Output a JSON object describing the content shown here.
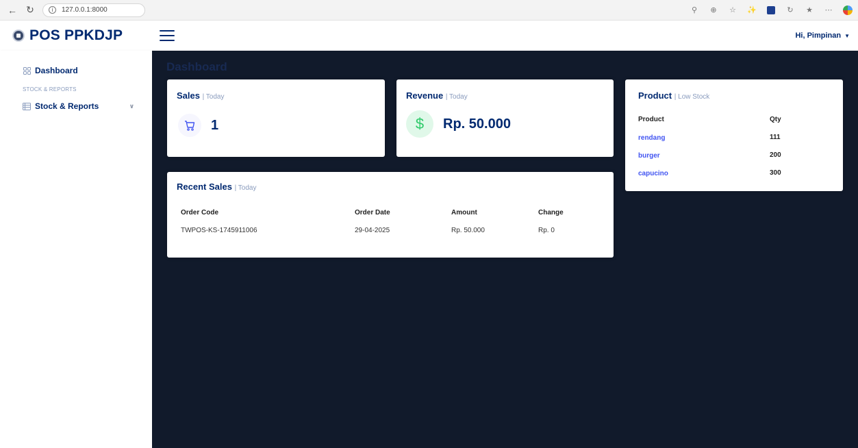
{
  "browser": {
    "url": "127.0.0.1:8000"
  },
  "header": {
    "brand": "POS PPKDJP",
    "user_greeting": "Hi, Pimpinan"
  },
  "sidebar": {
    "items": [
      {
        "label": "Dashboard"
      }
    ],
    "section_heading": "STOCK & REPORTS",
    "group": {
      "label": "Stock & Reports"
    }
  },
  "main": {
    "page_title": "Dashboard",
    "sales_card": {
      "title": "Sales",
      "subtitle": "| Today",
      "value": "1"
    },
    "revenue_card": {
      "title": "Revenue",
      "subtitle": "| Today",
      "value": "Rp. 50.000"
    },
    "product_card": {
      "title": "Product",
      "subtitle": "| Low Stock",
      "headers": [
        "Product",
        "Qty"
      ],
      "rows": [
        {
          "product": "rendang",
          "qty": "111"
        },
        {
          "product": "burger",
          "qty": "200"
        },
        {
          "product": "capucino",
          "qty": "300"
        }
      ]
    },
    "recent_sales": {
      "title": "Recent Sales",
      "subtitle": "| Today",
      "headers": [
        "Order Code",
        "Order Date",
        "Amount",
        "Change"
      ],
      "rows": [
        {
          "code": "TWPOS-KS-1745911006",
          "date": "29-04-2025",
          "amount": "Rp. 50.000",
          "change": "Rp. 0"
        }
      ]
    }
  },
  "colors": {
    "brand": "#012970",
    "main_bg": "#111a2b",
    "link": "#4154f1",
    "sales_icon_bg": "#f6f6fe",
    "revenue_icon_bg": "#e0f8e9"
  }
}
